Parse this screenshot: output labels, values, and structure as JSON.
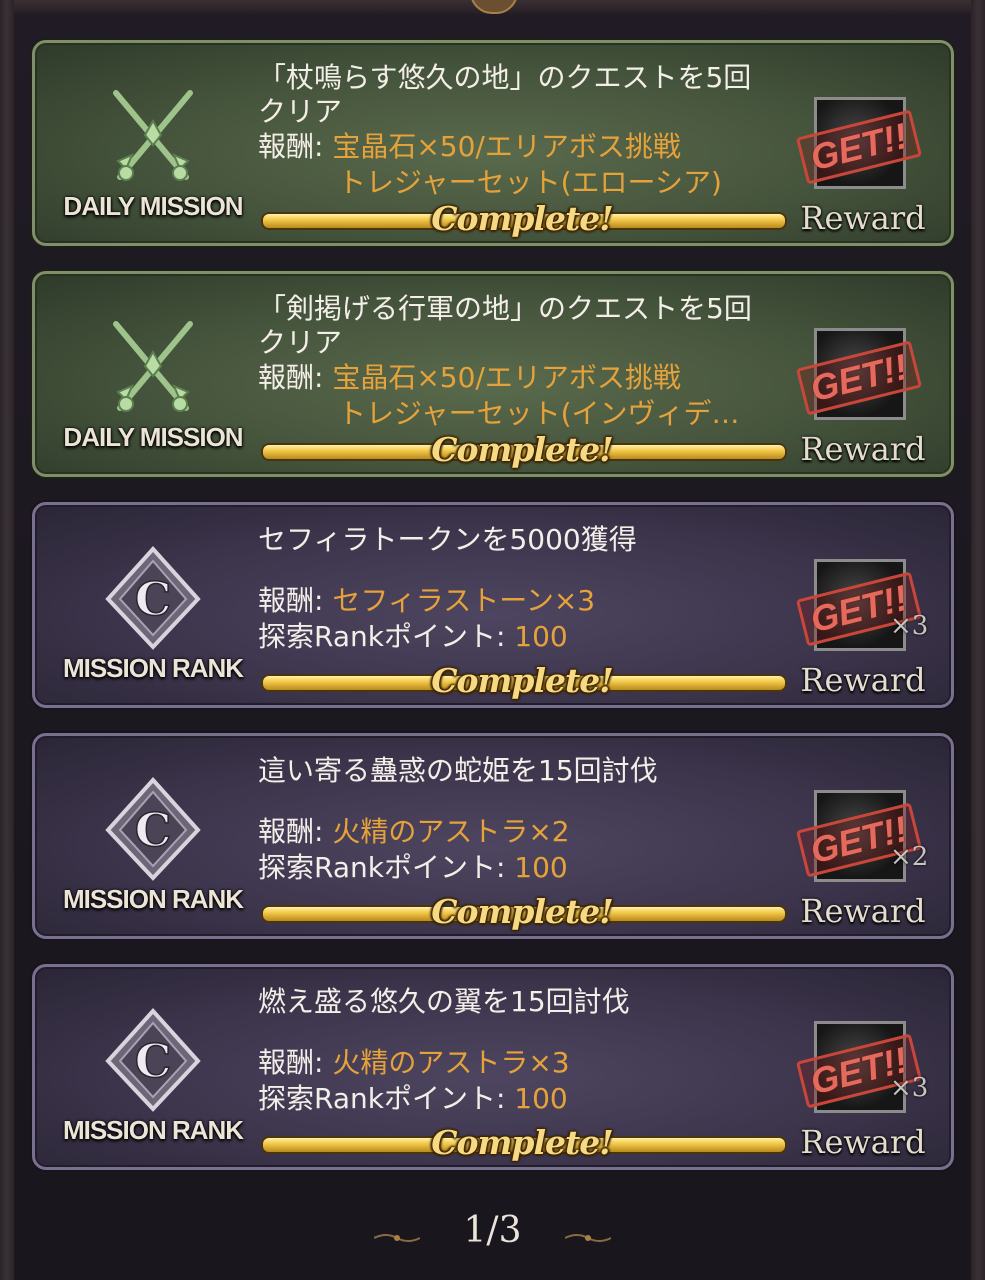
{
  "pager": {
    "current_page": 1,
    "total_pages": 3,
    "label": "1/3"
  },
  "colors": {
    "daily_card": "#44533b",
    "rank_card": "#3d354c",
    "reward_value": "#e6a23a",
    "complete_bar": "#f3c94a",
    "get_stamp": "#c8473a"
  },
  "missions": [
    {
      "type": "daily",
      "emblem_icon": "crossed-swords-icon",
      "emblem_label": "DAILY MISSION",
      "title_line1": "「杖鳴らす悠久の地」のクエストを5回",
      "title_line2": "クリア",
      "reward_prefix": "報酬: ",
      "reward_value": "宝晶石×50/エリアボス挑戦",
      "reward_value_line2": "トレジャーセット(エローシア)",
      "status": "Complete!",
      "progress": 1.0,
      "stamp": "GET!!",
      "reward_label": "Reward",
      "quantity": ""
    },
    {
      "type": "daily",
      "emblem_icon": "crossed-swords-icon",
      "emblem_label": "DAILY MISSION",
      "title_line1": "「剣掲げる行軍の地」のクエストを5回",
      "title_line2": "クリア",
      "reward_prefix": "報酬: ",
      "reward_value": "宝晶石×50/エリアボス挑戦",
      "reward_value_line2": "トレジャーセット(インヴィデ…",
      "status": "Complete!",
      "progress": 1.0,
      "stamp": "GET!!",
      "reward_label": "Reward",
      "quantity": ""
    },
    {
      "type": "rank",
      "emblem_icon": "rank-c-icon",
      "emblem_label": "MISSION RANK",
      "title_line1": "セフィラトークンを5000獲得",
      "reward_prefix": "報酬: ",
      "reward_value": "セフィラストーン×3",
      "points_prefix": "探索Rankポイント: ",
      "points_value": "100",
      "status": "Complete!",
      "progress": 1.0,
      "stamp": "GET!!",
      "reward_label": "Reward",
      "quantity": "×3"
    },
    {
      "type": "rank",
      "emblem_icon": "rank-c-icon",
      "emblem_label": "MISSION RANK",
      "title_line1": "這い寄る蠱惑の蛇姫を15回討伐",
      "reward_prefix": "報酬: ",
      "reward_value": "火精のアストラ×2",
      "points_prefix": "探索Rankポイント: ",
      "points_value": "100",
      "status": "Complete!",
      "progress": 1.0,
      "stamp": "GET!!",
      "reward_label": "Reward",
      "quantity": "×2"
    },
    {
      "type": "rank",
      "emblem_icon": "rank-c-icon",
      "emblem_label": "MISSION RANK",
      "title_line1": "燃え盛る悠久の翼を15回討伐",
      "reward_prefix": "報酬: ",
      "reward_value": "火精のアストラ×3",
      "points_prefix": "探索Rankポイント: ",
      "points_value": "100",
      "status": "Complete!",
      "progress": 1.0,
      "stamp": "GET!!",
      "reward_label": "Reward",
      "quantity": "×3"
    }
  ]
}
